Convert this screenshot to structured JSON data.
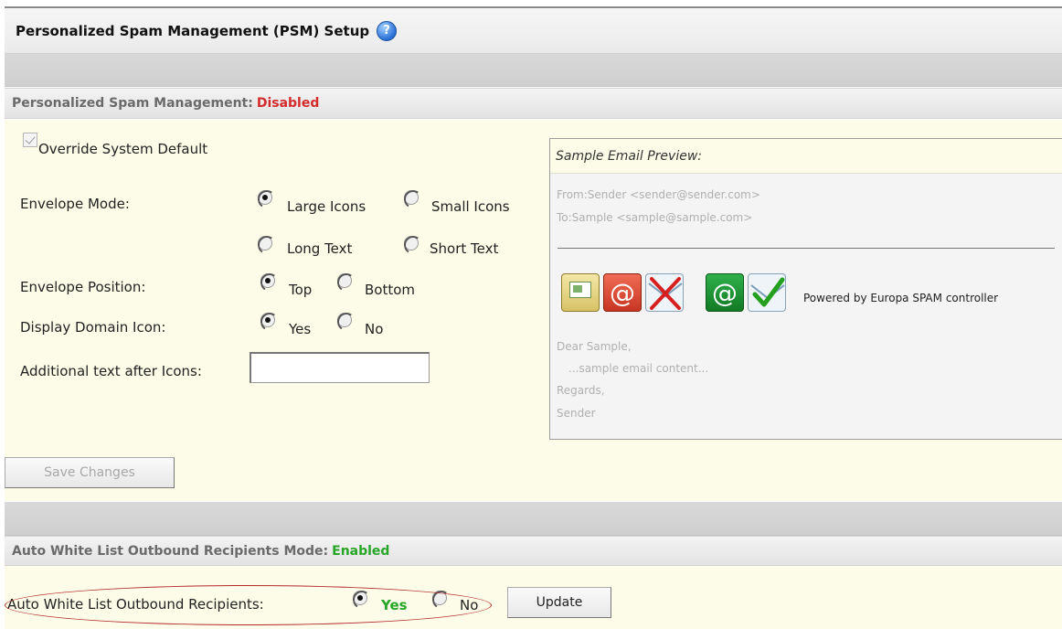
{
  "header": {
    "title": "Personalized Spam Management (PSM) Setup",
    "help_icon": "help-icon"
  },
  "psm_section": {
    "label": "Personalized Spam Management:",
    "status": "Disabled",
    "status_color": "#d42b2b",
    "override": {
      "label": "Override System Default",
      "checked": true,
      "disabled": true
    },
    "envelope_mode": {
      "label": "Envelope Mode:",
      "options": [
        "Large Icons",
        "Small Icons",
        "Long Text",
        "Short Text"
      ],
      "selected": "Large Icons"
    },
    "envelope_position": {
      "label": "Envelope Position:",
      "options": [
        "Top",
        "Bottom"
      ],
      "selected": "Top"
    },
    "display_domain_icon": {
      "label": "Display Domain Icon:",
      "options": [
        "Yes",
        "No"
      ],
      "selected": "Yes"
    },
    "additional_text": {
      "label": "Additional text after Icons:",
      "value": ""
    },
    "save_button": "Save Changes"
  },
  "preview": {
    "title": "Sample Email Preview:",
    "from": "From:Sender <sender@sender.com>",
    "to": "To:Sample <sample@sample.com>",
    "icons": [
      "envelope-icon",
      "at-sign-red-icon",
      "blocked-envelope-icon",
      "at-sign-green-icon",
      "approved-envelope-icon"
    ],
    "powered_by": "Powered by Europa SPAM controller",
    "body": [
      "Dear Sample,",
      "...sample email content...",
      "Regards,",
      "Sender"
    ]
  },
  "awl_section": {
    "label": "Auto White List Outbound Recipients Mode:",
    "status": "Enabled",
    "status_color": "#28a628",
    "field_label": "Auto White List Outbound Recipients:",
    "options": [
      "Yes",
      "No"
    ],
    "selected": "Yes",
    "update_button": "Update"
  }
}
